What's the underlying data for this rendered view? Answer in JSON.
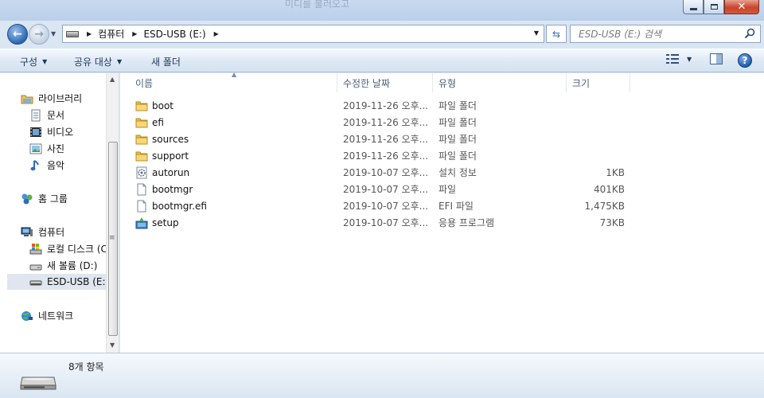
{
  "window": {
    "ghost_title": "미디를 불러오고"
  },
  "address": {
    "crumbs": [
      "컴퓨터",
      "ESD-USB (E:)"
    ],
    "search_placeholder": "ESD-USB (E:) 검색"
  },
  "toolbar": {
    "organize": "구성",
    "share": "공유 대상",
    "new_folder": "새 폴더"
  },
  "nav": {
    "library": "라이브러리",
    "documents": "문서",
    "videos": "비디오",
    "pictures": "사진",
    "music": "음악",
    "homegroup": "홈 그룹",
    "computer": "컴퓨터",
    "local_disk": "로컬 디스크 (C:)",
    "new_volume": "새 볼륨 (D:)",
    "usb": "ESD-USB (E:)",
    "network": "네트워크"
  },
  "columns": {
    "name": "이름",
    "date": "수정한 날짜",
    "type": "유형",
    "size": "크기"
  },
  "files": [
    {
      "name": "boot",
      "date": "2019-11-26 오후...",
      "type": "파일 폴더",
      "size": "",
      "icon": "folder-icon"
    },
    {
      "name": "efi",
      "date": "2019-11-26 오후...",
      "type": "파일 폴더",
      "size": "",
      "icon": "folder-icon"
    },
    {
      "name": "sources",
      "date": "2019-11-26 오후...",
      "type": "파일 폴더",
      "size": "",
      "icon": "folder-icon"
    },
    {
      "name": "support",
      "date": "2019-11-26 오후...",
      "type": "파일 폴더",
      "size": "",
      "icon": "folder-icon"
    },
    {
      "name": "autorun",
      "date": "2019-10-07 오후...",
      "type": "설치 정보",
      "size": "1KB",
      "icon": "setup-info-icon"
    },
    {
      "name": "bootmgr",
      "date": "2019-10-07 오후...",
      "type": "파일",
      "size": "401KB",
      "icon": "file-icon"
    },
    {
      "name": "bootmgr.efi",
      "date": "2019-10-07 오후...",
      "type": "EFI 파일",
      "size": "1,475KB",
      "icon": "file-icon"
    },
    {
      "name": "setup",
      "date": "2019-10-07 오후...",
      "type": "응용 프로그램",
      "size": "73KB",
      "icon": "setup-app-icon"
    }
  ],
  "status": {
    "item_count": "8개 항목"
  }
}
